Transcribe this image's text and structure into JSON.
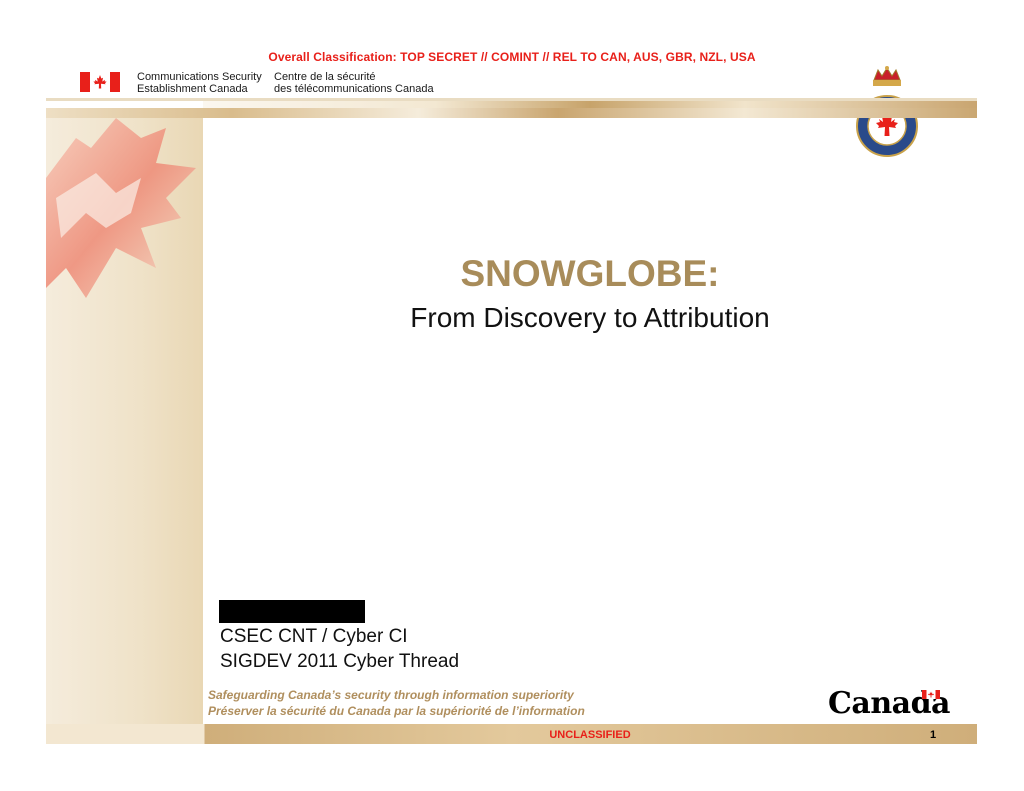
{
  "classification": {
    "top": "Overall Classification: TOP SECRET // COMINT // REL TO CAN, AUS, GBR, NZL, USA",
    "bottom": "UNCLASSIFIED"
  },
  "header": {
    "org_en_line1": "Communications Security",
    "org_en_line2": "Establishment Canada",
    "org_fr_line1": "Centre de la sécurité",
    "org_fr_line2": "des télécommunications Canada"
  },
  "slide": {
    "title": "SNOWGLOBE:",
    "subtitle": "From Discovery to Attribution",
    "author_line1": "CSEC CNT / Cyber CI",
    "author_line2": "SIGDEV 2011 Cyber Thread",
    "page_number": "1"
  },
  "footer": {
    "tagline_en": "Safeguarding Canada’s security through information superiority",
    "tagline_fr": "Préserver la sécurité du Canada par la supériorité de l’information",
    "wordmark": "Canada"
  },
  "colors": {
    "classification_red": "#e8201a",
    "title_gold": "#a88c5a",
    "tagline_gold": "#b08f5e",
    "flag_red": "#e8201a"
  },
  "icons": [
    "canada-flag-icon",
    "csec-crest-icon",
    "maple-leaf-icon"
  ]
}
